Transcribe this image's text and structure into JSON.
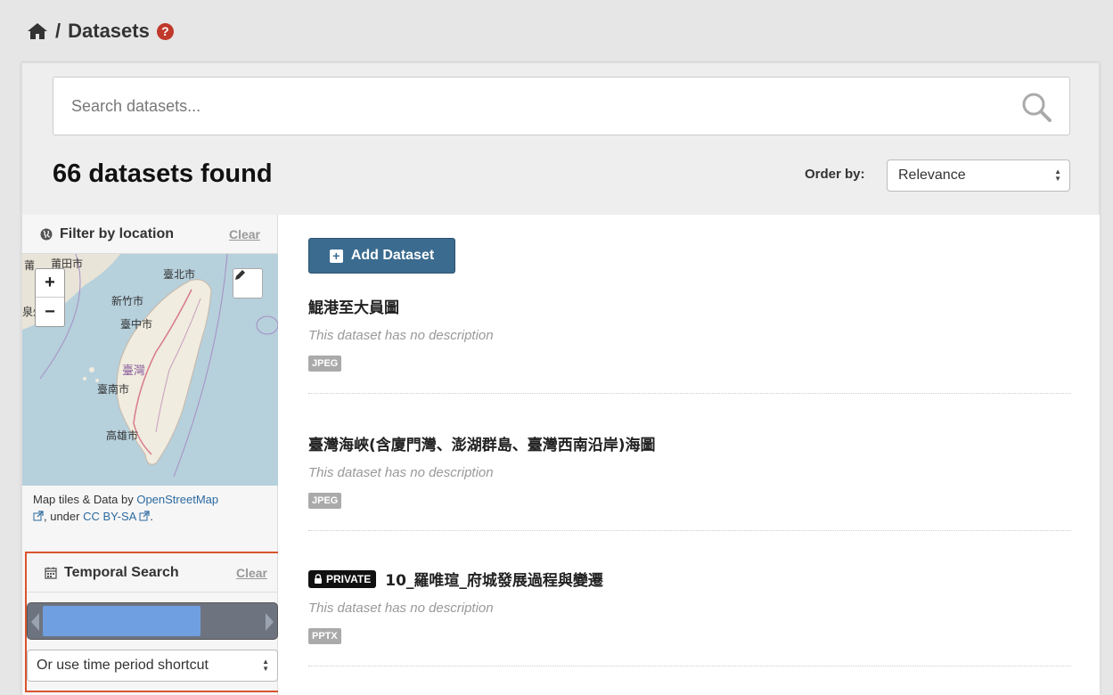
{
  "breadcrumb": {
    "separator": "/",
    "current": "Datasets",
    "help_glyph": "?"
  },
  "search": {
    "placeholder": "Search datasets...",
    "value": ""
  },
  "results": {
    "count_text": "66 datasets found"
  },
  "order": {
    "label": "Order by:",
    "selected": "Relevance"
  },
  "location_filter": {
    "title": "Filter by location",
    "clear": "Clear",
    "zoom_in": "+",
    "zoom_out": "−",
    "map_labels": {
      "putian": "莆田市",
      "taipei": "臺北市",
      "hsinchu": "新竹市",
      "taichung": "臺中市",
      "taiwan": "臺灣",
      "tainan": "臺南市",
      "kaohsiung": "高雄市",
      "edge_left": "莆",
      "edge_left2": "泉州"
    },
    "attribution_prefix": "Map tiles & Data by ",
    "attribution_link1": "OpenStreetMap",
    "attribution_middle": ", under ",
    "attribution_link2": "CC BY-SA",
    "attribution_suffix": "."
  },
  "temporal": {
    "title": "Temporal Search",
    "clear": "Clear",
    "range_fill_fraction": 0.72,
    "shortcut_selected": "Or use time period shortcut"
  },
  "add_dataset": {
    "label": "Add Dataset",
    "icon_glyph": "+"
  },
  "datasets": [
    {
      "title": "鯤港至大員圖",
      "description": "This dataset has no description",
      "format": "JPEG",
      "private": false
    },
    {
      "title": "臺灣海峽(含廈門灣、澎湖群島、臺灣西南沿岸)海圖",
      "description": "This dataset has no description",
      "format": "JPEG",
      "private": false
    },
    {
      "title": "10_羅唯瑄_府城發展過程與變遷",
      "description": "This dataset has no description",
      "format": "PPTX",
      "private": true,
      "private_label": "PRIVATE"
    }
  ],
  "colors": {
    "accent": "#3b6b8f",
    "highlight_border": "#d9542f",
    "link": "#2c6aa0",
    "slider_fill": "#6f9fe0"
  }
}
